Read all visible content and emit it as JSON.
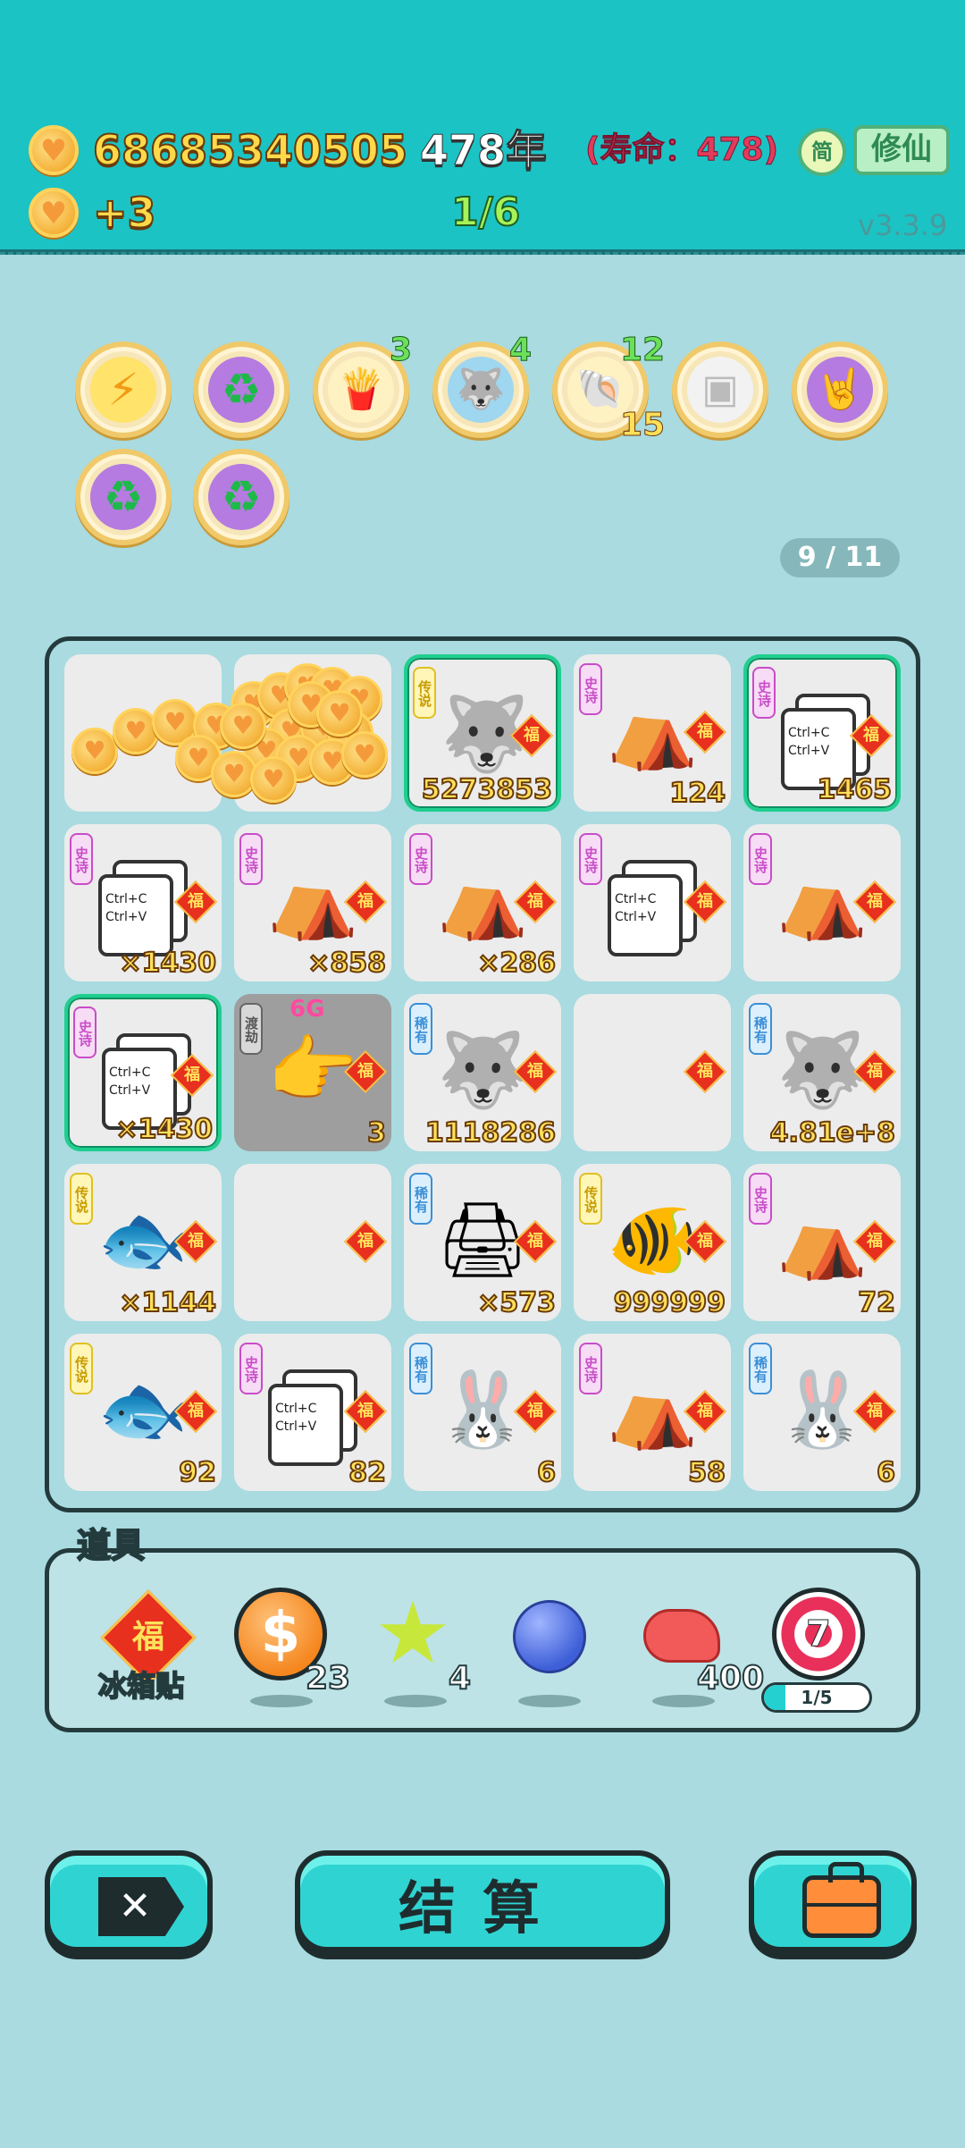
{
  "header": {
    "coins": "68685340505",
    "coin_income": "+3",
    "year": "478年",
    "lifespan": "(寿命：478)",
    "stage_progress": "1/6",
    "simplified_label": "简",
    "cultivation_label": "修仙",
    "version": "v3.3.9"
  },
  "buffs": [
    {
      "icon": "lightning-icon",
      "count": ""
    },
    {
      "icon": "recycle-icon",
      "count": ""
    },
    {
      "icon": "fries-icon",
      "count": "3"
    },
    {
      "icon": "husky-icon",
      "count": "4"
    },
    {
      "icon": "shell-icon",
      "count": "12",
      "count2": "15"
    },
    {
      "icon": "sugar-cubes-icon",
      "count": ""
    },
    {
      "icon": "rock-hand-icon",
      "count": ""
    },
    {
      "icon": "recycle-icon",
      "count": ""
    },
    {
      "icon": "recycle-icon",
      "count": ""
    }
  ],
  "pager": "9 / 11",
  "board": {
    "cells": [
      {
        "rarity": "",
        "item": "coins",
        "value": ""
      },
      {
        "rarity": "",
        "item": "coins",
        "value": ""
      },
      {
        "rarity": "传说",
        "item": "husky-king",
        "value": "5273853"
      },
      {
        "rarity": "史诗",
        "item": "rabbit-tent",
        "value": "124"
      },
      {
        "rarity": "史诗",
        "item": "copy-paste",
        "value": "1465"
      },
      {
        "rarity": "史诗",
        "item": "copy-paste",
        "value": "×1430"
      },
      {
        "rarity": "史诗",
        "item": "rabbit-tent",
        "value": "×858"
      },
      {
        "rarity": "史诗",
        "item": "rabbit-tent",
        "value": "×286"
      },
      {
        "rarity": "史诗",
        "item": "copy-paste",
        "value": ""
      },
      {
        "rarity": "史诗",
        "item": "rabbit-tent",
        "value": ""
      },
      {
        "rarity": "史诗",
        "item": "copy-paste",
        "value": "×1430"
      },
      {
        "rarity": "渡劫",
        "item": "pointing-hand",
        "value": "3",
        "tag": "6G"
      },
      {
        "rarity": "稀有",
        "item": "husky",
        "value": "1118286"
      },
      {
        "rarity": "",
        "item": "empty",
        "value": ""
      },
      {
        "rarity": "稀有",
        "item": "husky",
        "value": "4.81e+8"
      },
      {
        "rarity": "传说",
        "item": "koi-fish",
        "value": "×1144"
      },
      {
        "rarity": "",
        "item": "empty",
        "value": ""
      },
      {
        "rarity": "稀有",
        "item": "printer",
        "value": "×573"
      },
      {
        "rarity": "传说",
        "item": "koi-king",
        "value": "999999"
      },
      {
        "rarity": "史诗",
        "item": "rabbit-tent",
        "value": "72"
      },
      {
        "rarity": "传说",
        "item": "koi-fish",
        "value": "92"
      },
      {
        "rarity": "史诗",
        "item": "copy-paste",
        "value": "82"
      },
      {
        "rarity": "稀有",
        "item": "rabbit",
        "value": "6"
      },
      {
        "rarity": "史诗",
        "item": "rabbit-tent",
        "value": "58"
      },
      {
        "rarity": "稀有",
        "item": "rabbit",
        "value": "6"
      }
    ],
    "fu_label": "福",
    "copy_text": "Ctrl+C\nCtrl+V"
  },
  "tray": {
    "title": "道具",
    "fridge_sticker_label": "冰箱贴",
    "coin_count": "23",
    "star_count": "4",
    "liver_count": "400",
    "target_number": "7",
    "target_progress_text": "1/5",
    "target_progress_fraction": 0.2
  },
  "buttons": {
    "settle_label": "结算"
  },
  "colors": {
    "header_bg": "#1cc3c5",
    "page_bg": "#a9dbe0",
    "accent_button": "#2fd4d2",
    "coin_text": "#ffd94a",
    "life_text": "#e23b5c",
    "progress_text": "#a7f25a"
  }
}
